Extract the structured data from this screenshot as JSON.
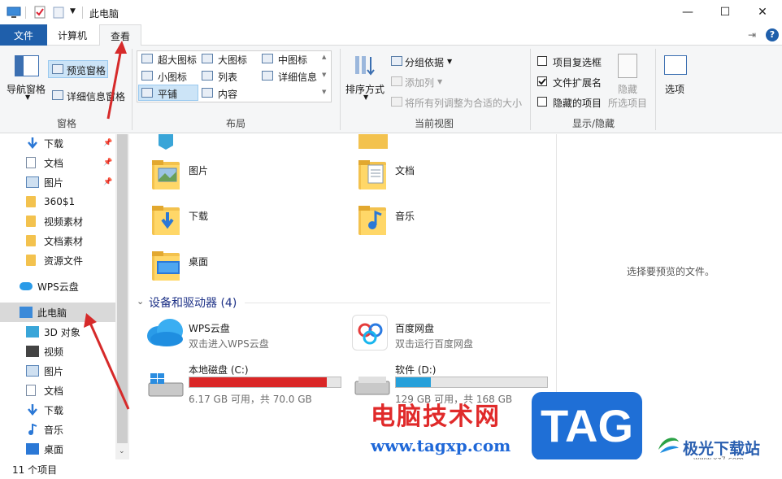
{
  "window": {
    "title": "此电脑",
    "minimize": "—",
    "maximize": "☐",
    "close": "✕"
  },
  "tabs": [
    {
      "label": "文件"
    },
    {
      "label": "计算机"
    },
    {
      "label": "查看"
    }
  ],
  "ribbon": {
    "panes": {
      "label": "窗格",
      "nav_pane": "导航窗格",
      "preview_pane": "预览窗格",
      "details_pane": "详细信息窗格"
    },
    "layout": {
      "label": "布局",
      "options": [
        "超大图标",
        "大图标",
        "中图标",
        "小图标",
        "列表",
        "详细信息",
        "平铺",
        "内容"
      ],
      "selected": "平铺"
    },
    "current_view": {
      "label": "当前视图",
      "sort_by": "排序方式",
      "group_by": "分组依据",
      "add_column": "添加列",
      "fit_columns": "将所有列调整为合适的大小"
    },
    "show_hide": {
      "label": "显示/隐藏",
      "item_checkboxes": {
        "label": "项目复选框",
        "checked": false
      },
      "file_extensions": {
        "label": "文件扩展名",
        "checked": true
      },
      "hidden_items": {
        "label": "隐藏的项目",
        "checked": false
      },
      "hide_selected": "隐藏",
      "hide_selected_2": "所选项目"
    },
    "options": "选项"
  },
  "nav": {
    "items": [
      {
        "label": "下载",
        "icon": "download-icon",
        "pinned": true
      },
      {
        "label": "文档",
        "icon": "document-icon",
        "pinned": true
      },
      {
        "label": "图片",
        "icon": "picture-icon",
        "pinned": true
      },
      {
        "label": "360$1",
        "icon": "folder-icon"
      },
      {
        "label": "视频素材",
        "icon": "folder-icon"
      },
      {
        "label": "文档素材",
        "icon": "folder-icon"
      },
      {
        "label": "资源文件",
        "icon": "folder-icon"
      },
      {
        "label": "WPS云盘",
        "icon": "cloud-icon"
      },
      {
        "label": "此电脑",
        "icon": "computer-icon",
        "selected": true
      },
      {
        "label": "3D 对象",
        "icon": "cube-icon"
      },
      {
        "label": "视频",
        "icon": "video-icon"
      },
      {
        "label": "图片",
        "icon": "picture-icon"
      },
      {
        "label": "文档",
        "icon": "document-icon"
      },
      {
        "label": "下载",
        "icon": "download-icon"
      },
      {
        "label": "音乐",
        "icon": "music-icon"
      },
      {
        "label": "桌面",
        "icon": "desktop-icon"
      }
    ]
  },
  "content": {
    "folders": [
      {
        "label": "图片"
      },
      {
        "label": "文档"
      },
      {
        "label": "下载"
      },
      {
        "label": "音乐"
      },
      {
        "label": "桌面"
      }
    ],
    "devices_header": "设备和驱动器 (4)",
    "drives": [
      {
        "name": "WPS云盘",
        "sub": "双击进入WPS云盘"
      },
      {
        "name": "百度网盘",
        "sub": "双击运行百度网盘"
      },
      {
        "name": "本地磁盘 (C:)",
        "sub": "6.17 GB 可用，共 70.0 GB",
        "used_fraction": 0.91,
        "bar_color": "#da2626"
      },
      {
        "name": "软件 (D:)",
        "sub": "129 GB 可用，共 168 GB",
        "used_fraction": 0.23,
        "bar_color": "#26a0da"
      }
    ]
  },
  "preview": {
    "message": "选择要预览的文件。"
  },
  "status": {
    "count": "11 个项目"
  },
  "watermark": {
    "site_cn": "电脑技术网",
    "site_url": "www.tagxp.com",
    "logo": "TAG",
    "brand2": "极光下载站",
    "brand2_url": "www.xz7.com"
  }
}
